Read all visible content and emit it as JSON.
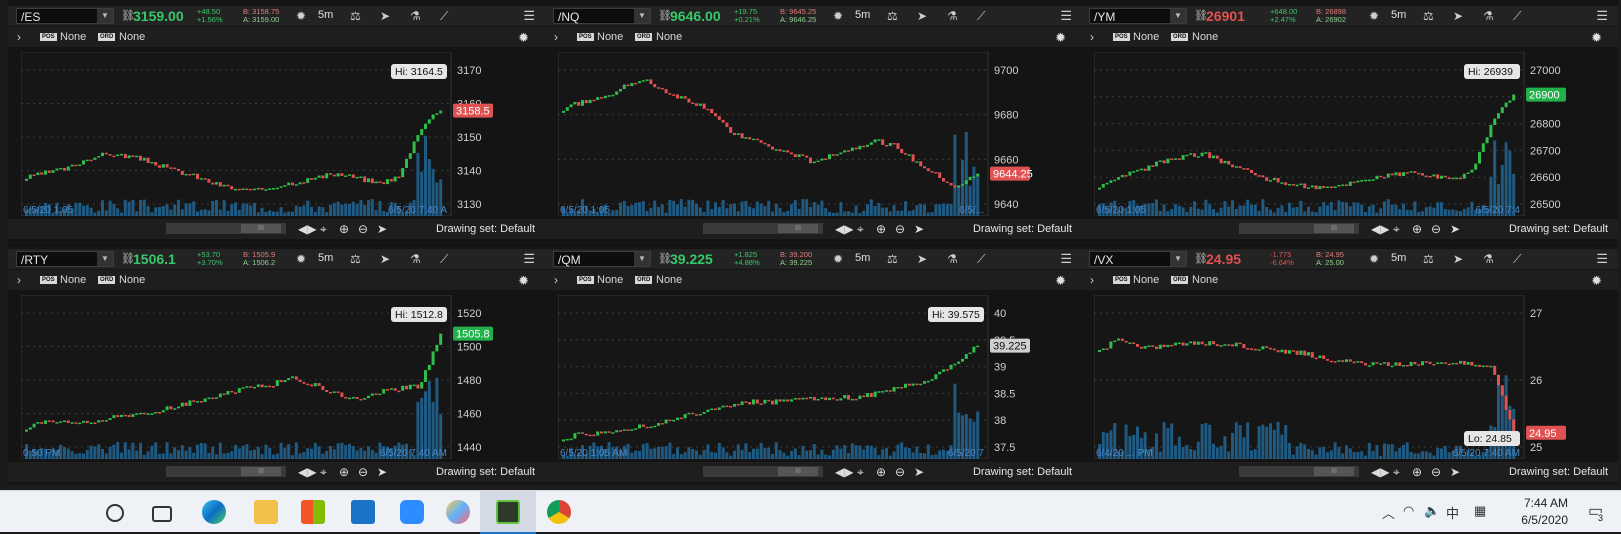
{
  "panels": [
    {
      "symbol": "/ES",
      "price": "3159.00",
      "price_color": "#37c86a",
      "change": "+48.50",
      "change_pct": "+1.56%",
      "bid": "B: 3158.75",
      "ask": "A: 3159.00",
      "timeframe": "5m",
      "pos": "None",
      "ord": "None",
      "y_ticks": [
        "3170",
        "3160",
        "3150",
        "3140",
        "3130"
      ],
      "x_left": "6/5/20 1:05",
      "x_right": "6/5/20 7:40 A",
      "hi_label": "Hi: 3164.5",
      "lo_label": "",
      "last_tag": "3158.5",
      "last_color": "#e05252",
      "trend": "es",
      "drawing_set": "Drawing set: Default"
    },
    {
      "symbol": "/NQ",
      "price": "9646.00",
      "price_color": "#37c86a",
      "change": "+19.75",
      "change_pct": "+0.21%",
      "bid": "B: 9645.25",
      "ask": "A: 9646.25",
      "timeframe": "5m",
      "pos": "None",
      "ord": "None",
      "y_ticks": [
        "9700",
        "9680",
        "9660",
        "9640"
      ],
      "x_left": "6/5/20 1:05",
      "x_right": "6/5/...",
      "hi_label": "",
      "lo_label": "",
      "last_tag": "9644.25",
      "last_color": "#e05252",
      "trend": "nq",
      "drawing_set": "Drawing set: Default"
    },
    {
      "symbol": "/YM",
      "price": "26901",
      "price_color": "#e05252",
      "change": "+648.00",
      "change_pct": "+2.47%",
      "bid": "B: 26898",
      "ask": "A: 26902",
      "timeframe": "5m",
      "pos": "None",
      "ord": "None",
      "y_ticks": [
        "27000",
        "26900",
        "26800",
        "26700",
        "26600",
        "26500"
      ],
      "x_left": "6/5/20 1:05",
      "x_right": "6/5/20 7:4",
      "hi_label": "Hi: 26939",
      "lo_label": "",
      "last_tag": "26900",
      "last_color": "#22b04a",
      "trend": "ym",
      "drawing_set": "Drawing set: Default"
    },
    {
      "symbol": "/RTY",
      "price": "1506.1",
      "price_color": "#37c86a",
      "change": "+53.70",
      "change_pct": "+3.70%",
      "bid": "B: 1505.9",
      "ask": "A: 1506.2",
      "timeframe": "5m",
      "pos": "None",
      "ord": "None",
      "y_ticks": [
        "1520",
        "1500",
        "1480",
        "1460",
        "1440"
      ],
      "x_left": "0:50 PM",
      "x_right": "6/5/20 7:40 AM",
      "hi_label": "Hi: 1512.8",
      "lo_label": "",
      "last_tag": "1505.8",
      "last_color": "#22b04a",
      "trend": "rty",
      "drawing_set": "Drawing set: Default"
    },
    {
      "symbol": "/QM",
      "price": "39.225",
      "price_color": "#37c86a",
      "change": "+1.825",
      "change_pct": "+4.88%",
      "bid": "B: 39.200",
      "ask": "A: 39.225",
      "timeframe": "5m",
      "pos": "None",
      "ord": "None",
      "y_ticks": [
        "40",
        "39.5",
        "39",
        "38.5",
        "38",
        "37.5"
      ],
      "x_left": "6/5/20 1:05 AM",
      "x_right": "6/5/20 7",
      "hi_label": "Hi: 39.575",
      "lo_label": "",
      "last_tag": "39.225",
      "last_color": "#cfcfcf",
      "trend": "qm",
      "drawing_set": "Drawing set: Default"
    },
    {
      "symbol": "/VX",
      "price": "24.95",
      "price_color": "#e05252",
      "change": "-1.775",
      "change_pct": "-6.64%",
      "bid": "B: 24.95",
      "ask": "A: 25.00",
      "timeframe": "5m",
      "pos": "None",
      "ord": "None",
      "y_ticks": [
        "27",
        "26",
        "25"
      ],
      "x_left": "6/4/20 ... PM",
      "x_right": "6/5/20 7:40 AM",
      "hi_label": "",
      "lo_label": "Lo: 24.85",
      "last_tag": "24.95",
      "last_color": "#e05252",
      "trend": "vx",
      "drawing_set": "Drawing set: Default"
    }
  ],
  "taskbar": {
    "time": "7:44 AM",
    "date": "6/5/2020",
    "ime": "中",
    "notifications": "3"
  }
}
